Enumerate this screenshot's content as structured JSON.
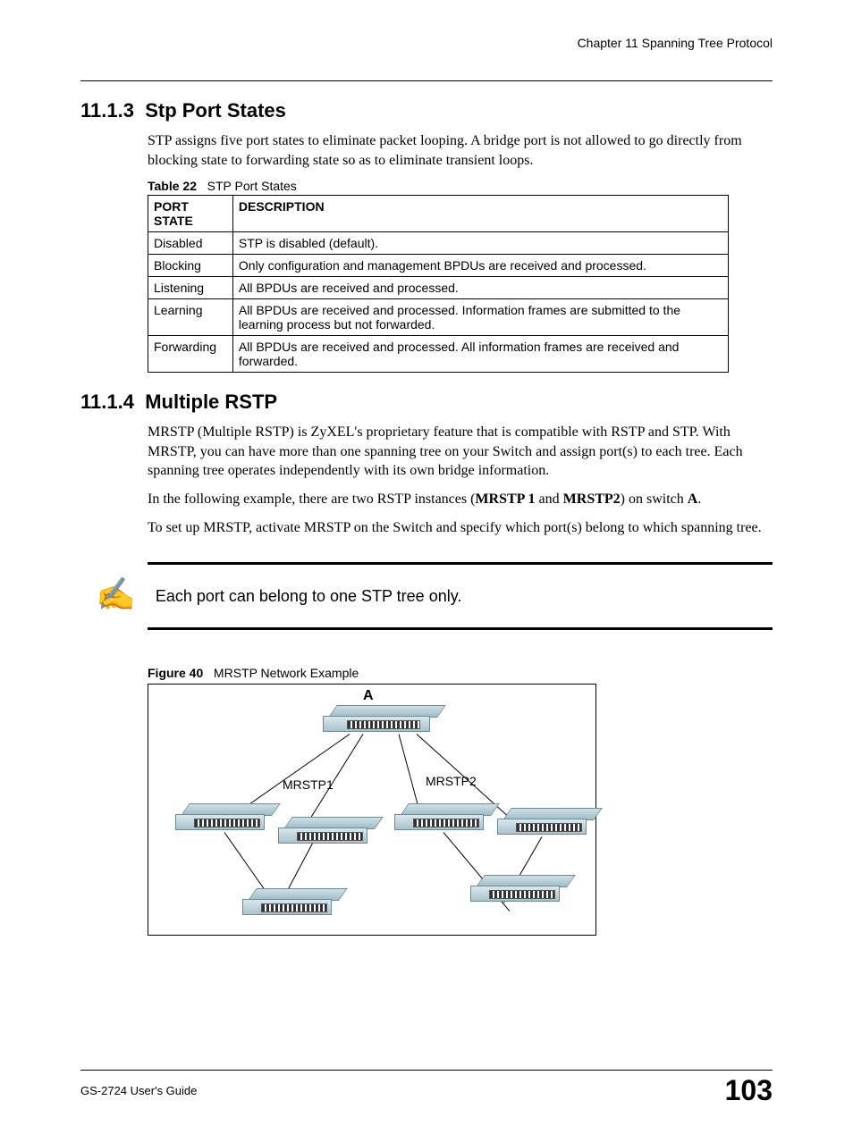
{
  "header": {
    "chapter": "Chapter 11 Spanning Tree Protocol"
  },
  "section1": {
    "number": "11.1.3",
    "title": "Stp Port States",
    "intro": "STP assigns five port states to eliminate packet looping. A bridge port is not allowed to go directly from blocking state to forwarding state so as to eliminate transient loops.",
    "table_caption_num": "Table 22",
    "table_caption_text": "STP Port States",
    "table": {
      "headers": [
        "PORT STATE",
        "DESCRIPTION"
      ],
      "rows": [
        [
          "Disabled",
          "STP is disabled (default)."
        ],
        [
          "Blocking",
          "Only configuration and management BPDUs are received and processed."
        ],
        [
          "Listening",
          "All BPDUs are received and processed."
        ],
        [
          "Learning",
          "All BPDUs are received and processed. Information frames are submitted to the learning process but not forwarded."
        ],
        [
          "Forwarding",
          "All BPDUs are received and processed. All information frames are received and forwarded."
        ]
      ]
    }
  },
  "section2": {
    "number": "11.1.4",
    "title": "Multiple RSTP",
    "p1": "MRSTP (Multiple RSTP) is ZyXEL's proprietary feature that is compatible with RSTP and STP. With MRSTP, you can have more than one spanning tree on your Switch and assign port(s) to each tree. Each spanning tree operates independently with its own bridge information.",
    "p2_pre": "In the following example, there are two RSTP instances (",
    "p2_b1": "MRSTP 1",
    "p2_mid": " and ",
    "p2_b2": "MRSTP2",
    "p2_post1": ") on switch ",
    "p2_b3": "A",
    "p2_post2": ".",
    "p3": "To set up MRSTP, activate MRSTP on the Switch and specify which port(s) belong to which spanning tree.",
    "note": "Each port can belong to one STP tree only.",
    "figure_caption_num": "Figure 40",
    "figure_caption_text": "MRSTP Network Example",
    "diagram": {
      "label_a": "A",
      "label_left": "MRSTP1",
      "label_right": "MRSTP2"
    }
  },
  "footer": {
    "guide": "GS-2724 User's Guide",
    "page": "103"
  }
}
